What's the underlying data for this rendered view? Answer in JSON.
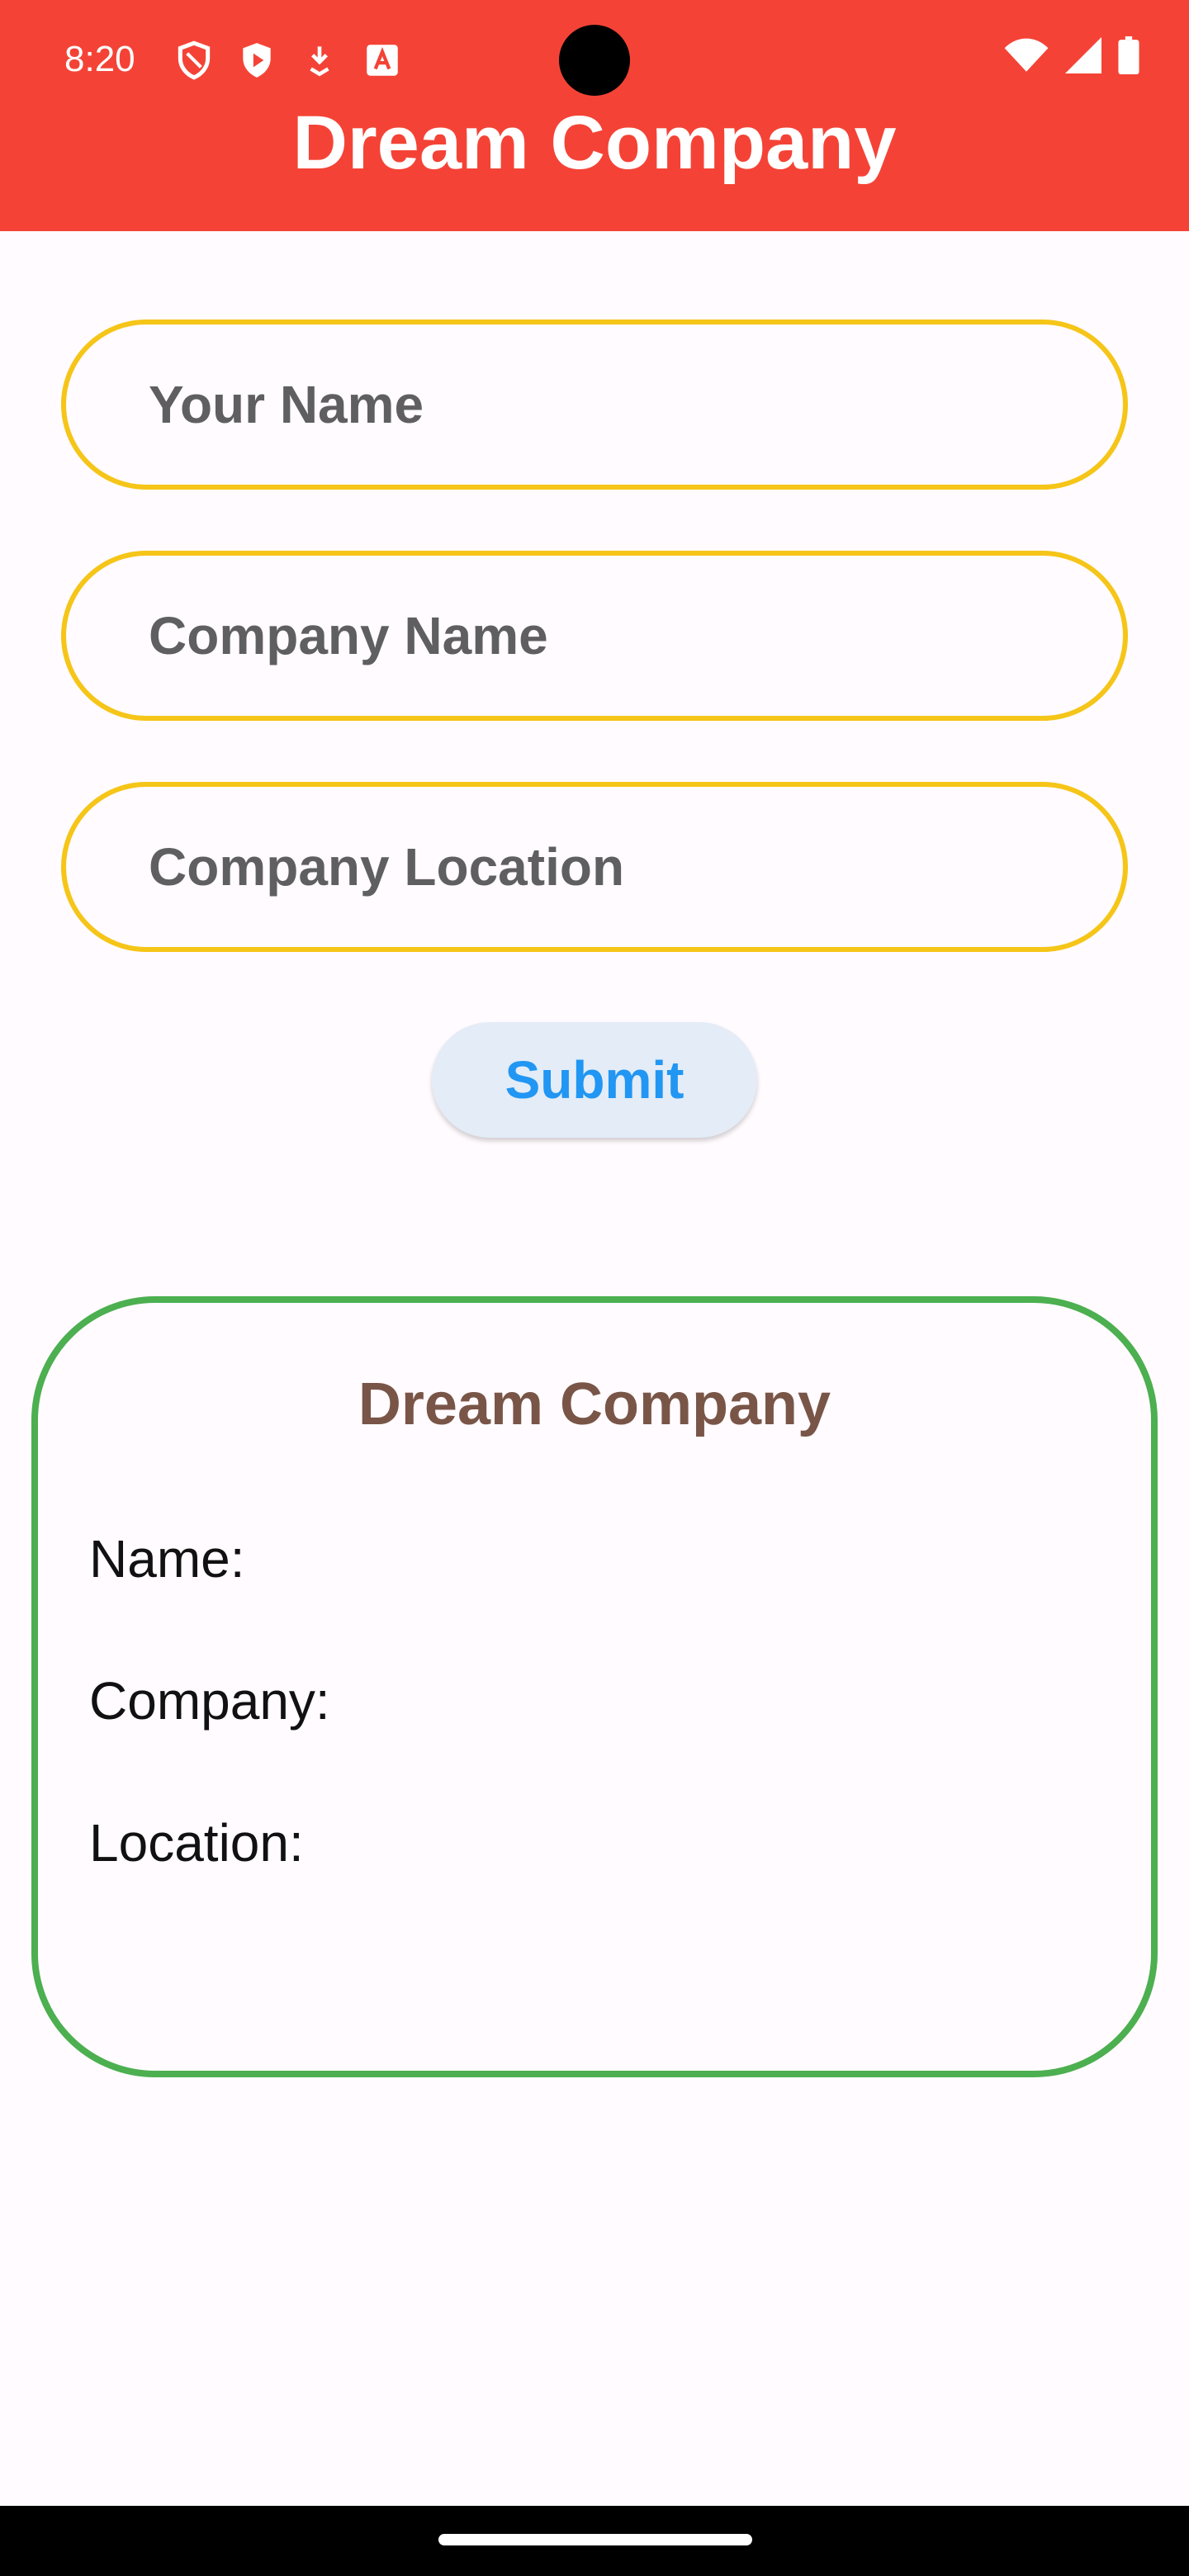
{
  "status_bar": {
    "time": "8:20",
    "left_icons": [
      "shield-outline-icon",
      "play-badge-icon",
      "download-icon",
      "font-icon"
    ],
    "right_icons": [
      "wifi-icon",
      "signal-icon",
      "battery-icon"
    ]
  },
  "app_bar": {
    "title": "Dream Company",
    "color": "#f44336"
  },
  "form": {
    "name_placeholder": "Your Name",
    "company_placeholder": "Company Name",
    "location_placeholder": "Company Location",
    "border_color": "#f5c518",
    "submit_label": "Submit"
  },
  "card": {
    "title": "Dream Company",
    "name_label": "Name:",
    "company_label": "Company:",
    "location_label": "Location:",
    "border_color": "#4caf50"
  }
}
